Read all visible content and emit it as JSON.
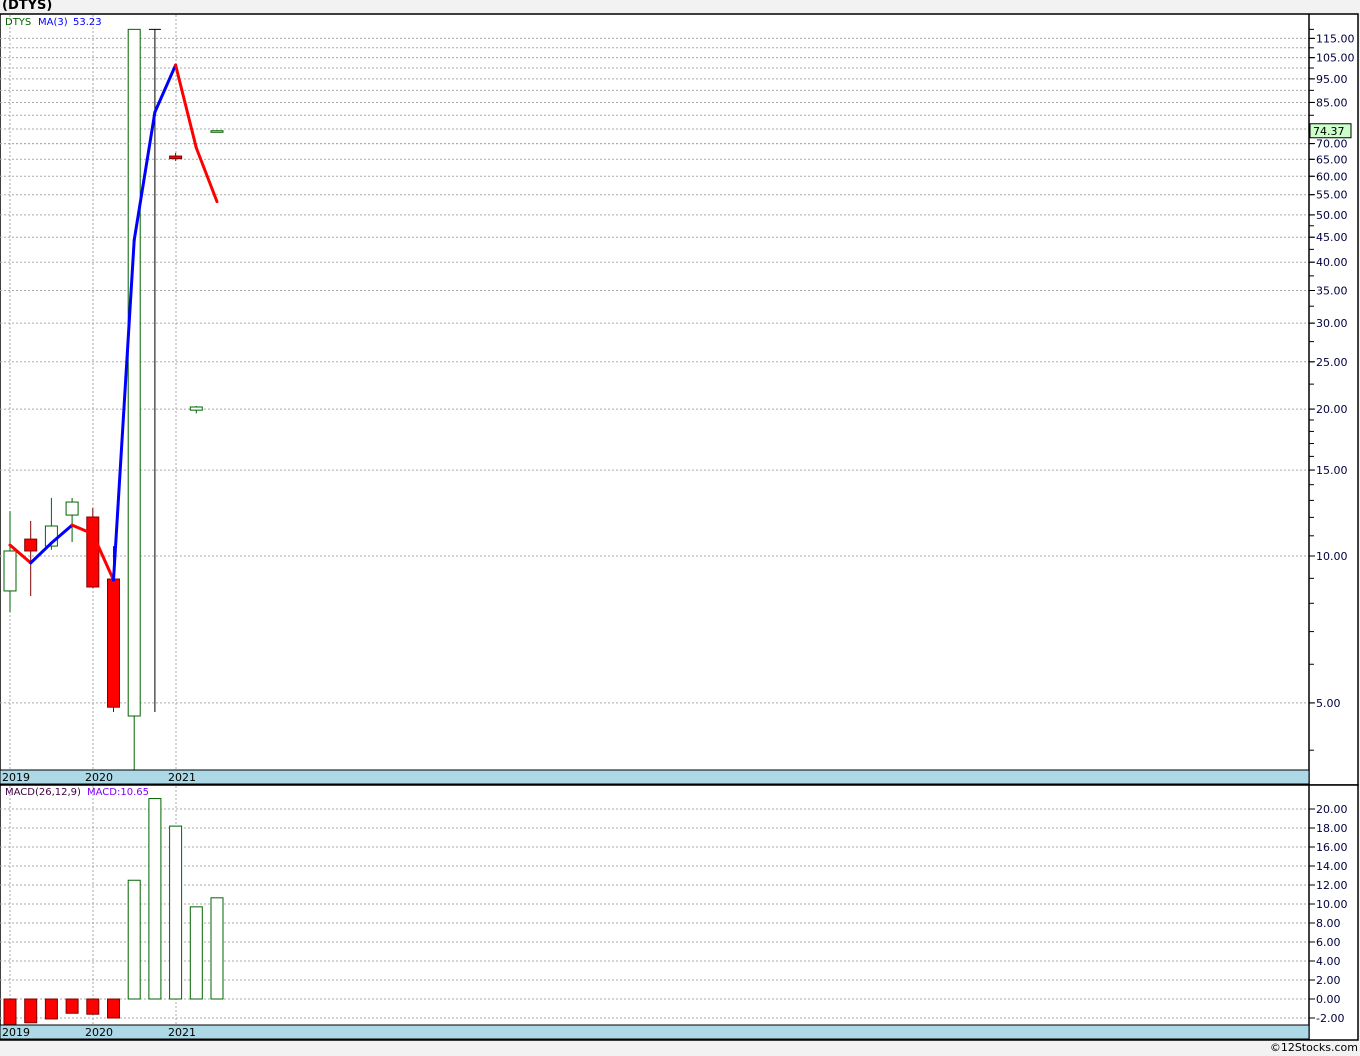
{
  "title": "(DTYS)",
  "footer": "©12Stocks.com",
  "colors": {
    "up": "#006400",
    "down": "#ff0000",
    "down_border": "#800000",
    "ma_up": "#0000ff",
    "ma_down": "#ff0000",
    "strip": "#add8e6",
    "last_price_bg": "#ccffcc"
  },
  "chart_data": [
    {
      "type": "candlestick",
      "scale": "log",
      "legend": {
        "symbol": "DTYS",
        "ma_label": "MA(3)",
        "ma_value": "53.23"
      },
      "last_price": "74.37",
      "x_tick_labels": [
        "2019",
        "2020",
        "2021"
      ],
      "y_tick_labels": [
        "115.00",
        "105.00",
        "95.00",
        "85.00",
        "75.00",
        "70.00",
        "65.00",
        "60.00",
        "55.00",
        "50.00",
        "45.00",
        "40.00",
        "35.00",
        "30.00",
        "25.00",
        "20.00",
        "15.00",
        "10.00",
        "5.00"
      ],
      "ylim": [
        3.6,
        122
      ],
      "grid": true,
      "candles": [
        {
          "o": 8.48,
          "h": 12.36,
          "l": 7.68,
          "c": 10.24
        },
        {
          "o": 10.83,
          "h": 11.8,
          "l": 8.28,
          "c": 10.24
        },
        {
          "o": 10.48,
          "h": 13.15,
          "l": 10.3,
          "c": 11.52
        },
        {
          "o": 12.13,
          "h": 13.15,
          "l": 10.68,
          "c": 12.9
        },
        {
          "o": 12.02,
          "h": 12.54,
          "l": 8.6,
          "c": 8.64
        },
        {
          "o": 8.97,
          "h": 10.48,
          "l": 4.79,
          "c": 4.9
        },
        {
          "o": 4.7,
          "h": 120,
          "l": 3.5,
          "c": 120
        },
        {
          "o": 120,
          "h": 120,
          "l": 4.79,
          "c": 120
        },
        {
          "o": 66,
          "h": 67,
          "l": 64.5,
          "c": 65.2
        },
        {
          "o": 19.9,
          "h": 20.3,
          "l": 19.6,
          "c": 20.2
        },
        {
          "o": 74.2,
          "h": 74.6,
          "l": 74.0,
          "c": 74.37
        }
      ],
      "ma3": [
        10.53,
        9.68,
        10.63,
        11.57,
        11.1,
        8.93,
        44.4,
        81.2,
        101.4,
        68.6,
        53.23
      ]
    },
    {
      "type": "bar",
      "legend": {
        "label": "MACD(26,12,9)",
        "value": "MACD:10.65"
      },
      "x_tick_labels": [
        "2019",
        "2020",
        "2021"
      ],
      "y_tick_labels": [
        "20.00",
        "18.00",
        "16.00",
        "14.00",
        "12.00",
        "10.00",
        "8.00",
        "6.00",
        "4.00",
        "2.00",
        "0.00",
        "-2.00"
      ],
      "ylim": [
        -2.8,
        22
      ],
      "grid": true,
      "values": [
        -2.7,
        -2.5,
        -2.1,
        -1.5,
        -1.6,
        -2.0,
        12.5,
        21.1,
        18.2,
        9.7,
        10.65
      ]
    }
  ]
}
